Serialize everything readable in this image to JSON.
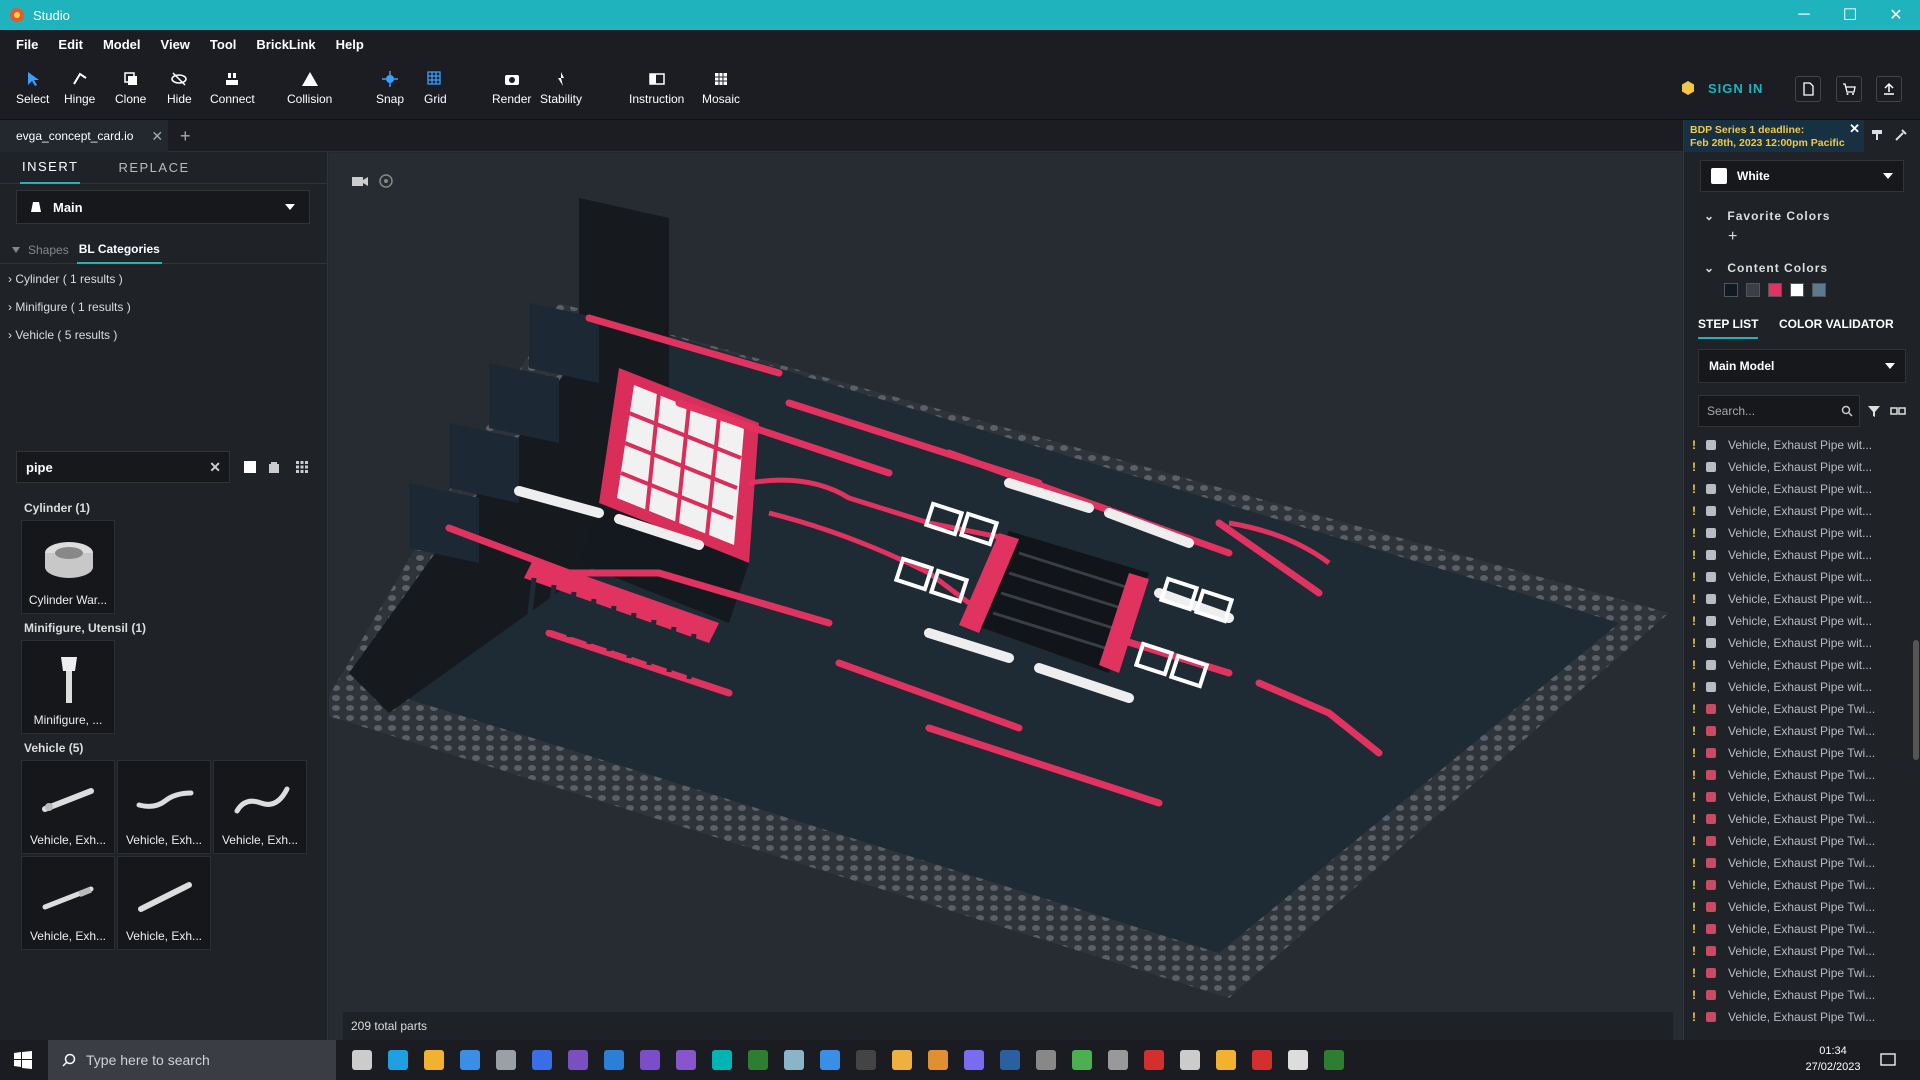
{
  "window": {
    "title": "Studio",
    "minimize": "─",
    "maximize": "☐",
    "close": "✕"
  },
  "menu": [
    "File",
    "Edit",
    "Model",
    "View",
    "Tool",
    "BrickLink",
    "Help"
  ],
  "toolbar": {
    "select": "Select",
    "hinge": "Hinge",
    "clone": "Clone",
    "hide": "Hide",
    "connect": "Connect",
    "collision": "Collision",
    "snap": "Snap",
    "grid": "Grid",
    "render": "Render",
    "stability": "Stability",
    "instruction": "Instruction",
    "mosaic": "Mosaic",
    "sign_in": "SIGN IN"
  },
  "document_tab": {
    "name": "evga_concept_card.io",
    "close": "✕",
    "add": "+"
  },
  "left_panel": {
    "tabs": [
      "INSERT",
      "REPLACE"
    ],
    "palette": "Main",
    "category_tabs": [
      "Shapes",
      "BL Categories"
    ],
    "tree": [
      "Cylinder ( 1 results )",
      "Minifigure ( 1 results )",
      "Vehicle ( 5 results )"
    ],
    "search_value": "pipe",
    "groups": [
      {
        "title": "Cylinder (1)",
        "items": [
          "Cylinder War..."
        ]
      },
      {
        "title": "Minifigure, Utensil (1)",
        "items": [
          "Minifigure, ..."
        ]
      },
      {
        "title": "Vehicle (5)",
        "items": [
          "Vehicle, Exh...",
          "Vehicle, Exh...",
          "Vehicle, Exh...",
          "Vehicle, Exh...",
          "Vehicle, Exh..."
        ]
      }
    ]
  },
  "viewport": {
    "parts_count": "209 total parts"
  },
  "right_panel": {
    "notice": {
      "line1": "BDP Series 1 deadline:",
      "line2": "Feb 28th, 2023 12:00pm Pacific",
      "close": "✕"
    },
    "color": "White",
    "favorite_colors": "Favorite Colors",
    "favorite_add": "+",
    "content_colors": "Content Colors",
    "content_swatches": [
      "#0e1a24",
      "#3a3f45",
      "#e0335f",
      "#ffffff",
      "#5a7a8f"
    ],
    "tabs": [
      "STEP LIST",
      "COLOR VALIDATOR"
    ],
    "model": "Main Model",
    "search_placeholder": "Search...",
    "steps": [
      "Vehicle, Exhaust Pipe wit...",
      "Vehicle, Exhaust Pipe wit...",
      "Vehicle, Exhaust Pipe wit...",
      "Vehicle, Exhaust Pipe wit...",
      "Vehicle, Exhaust Pipe wit...",
      "Vehicle, Exhaust Pipe wit...",
      "Vehicle, Exhaust Pipe wit...",
      "Vehicle, Exhaust Pipe wit...",
      "Vehicle, Exhaust Pipe wit...",
      "Vehicle, Exhaust Pipe wit...",
      "Vehicle, Exhaust Pipe wit...",
      "Vehicle, Exhaust Pipe wit...",
      "Vehicle, Exhaust Pipe Twi...",
      "Vehicle, Exhaust Pipe Twi...",
      "Vehicle, Exhaust Pipe Twi...",
      "Vehicle, Exhaust Pipe Twi...",
      "Vehicle, Exhaust Pipe Twi...",
      "Vehicle, Exhaust Pipe Twi...",
      "Vehicle, Exhaust Pipe Twi...",
      "Vehicle, Exhaust Pipe Twi...",
      "Vehicle, Exhaust Pipe Twi...",
      "Vehicle, Exhaust Pipe Twi...",
      "Vehicle, Exhaust Pipe Twi...",
      "Vehicle, Exhaust Pipe Twi...",
      "Vehicle, Exhaust Pipe Twi...",
      "Vehicle, Exhaust Pipe Twi...",
      "Vehicle, Exhaust Pipe Twi..."
    ],
    "step_warning": "!"
  },
  "taskbar": {
    "search_placeholder": "Type here to search",
    "time": "01:34",
    "date": "27/02/2023"
  },
  "colors": {
    "accent": "#1fb3bd",
    "brick_red": "#e0335f",
    "baseplate": "#3b3f46",
    "notice_text": "#f2c84b"
  }
}
